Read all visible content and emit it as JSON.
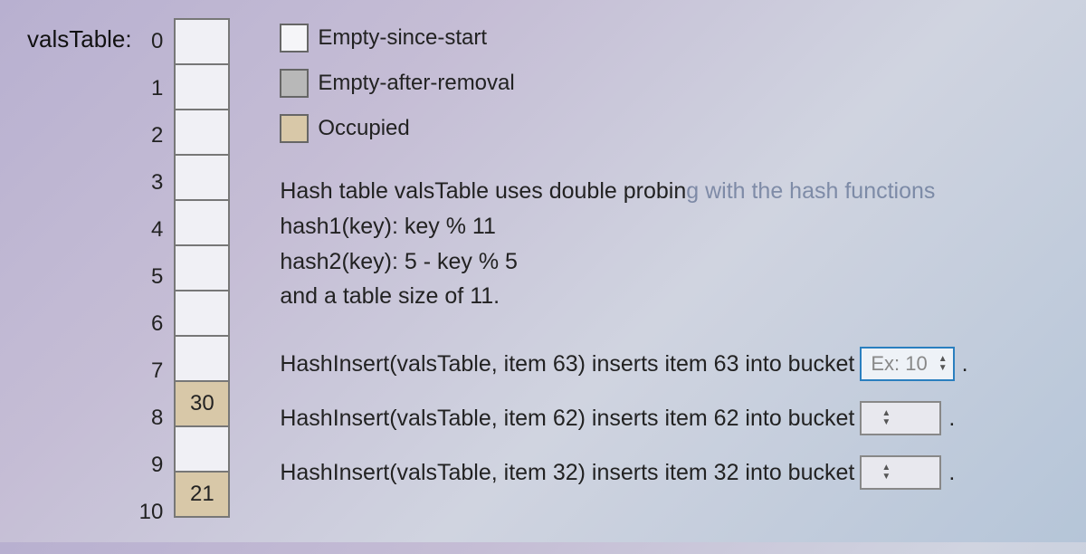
{
  "table": {
    "label": "valsTable:",
    "size": 11,
    "indices": [
      "0",
      "1",
      "2",
      "3",
      "4",
      "5",
      "6",
      "7",
      "8",
      "9",
      "10"
    ],
    "cells": [
      {
        "value": "",
        "state": "empty-start"
      },
      {
        "value": "",
        "state": "empty-start"
      },
      {
        "value": "",
        "state": "empty-start"
      },
      {
        "value": "",
        "state": "empty-start"
      },
      {
        "value": "",
        "state": "empty-start"
      },
      {
        "value": "",
        "state": "empty-start"
      },
      {
        "value": "",
        "state": "empty-start"
      },
      {
        "value": "",
        "state": "empty-start"
      },
      {
        "value": "30",
        "state": "occupied"
      },
      {
        "value": "",
        "state": "empty-start"
      },
      {
        "value": "21",
        "state": "occupied"
      }
    ]
  },
  "legend": {
    "ess": "Empty-since-start",
    "ear": "Empty-after-removal",
    "occ": "Occupied"
  },
  "description": {
    "line1a": "Hash table valsTable uses double probin",
    "line1b": "g with the hash functions",
    "line2": "hash1(key): key % 11",
    "line3": "hash2(key): 5 - key % 5",
    "line4": "and a table size of 11."
  },
  "questions": {
    "q1": {
      "text": "HashInsert(valsTable, item 63) inserts item 63 into bucket",
      "placeholder": "Ex: 10",
      "period": "."
    },
    "q2": {
      "text": "HashInsert(valsTable, item 62) inserts item 62 into bucket",
      "placeholder": "",
      "period": "."
    },
    "q3": {
      "text": "HashInsert(valsTable, item 32) inserts item 32 into bucket",
      "placeholder": "",
      "period": "."
    }
  }
}
